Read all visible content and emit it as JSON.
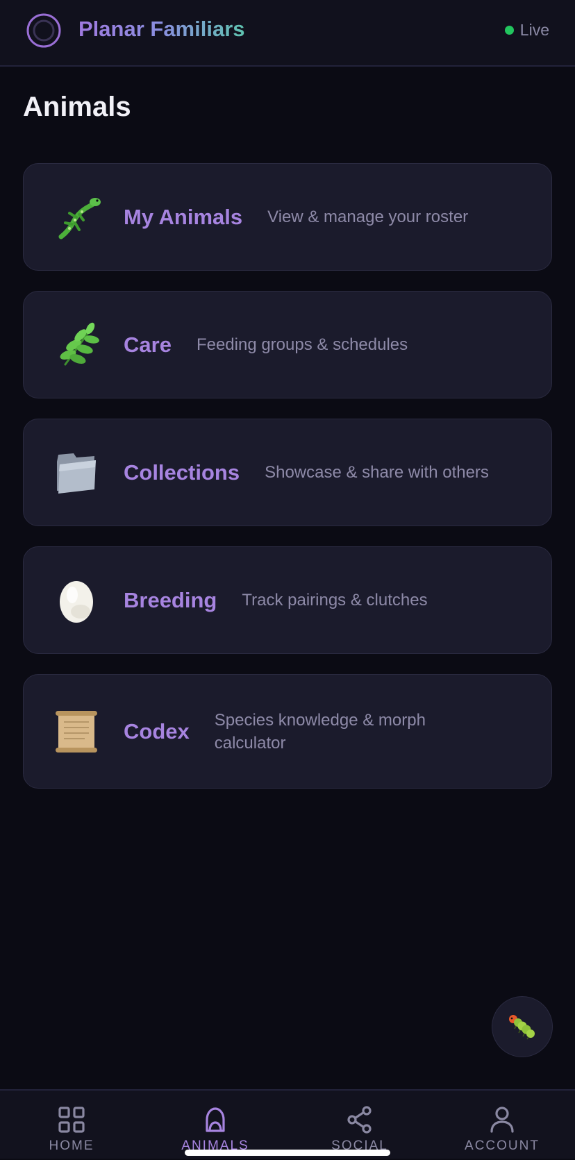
{
  "header": {
    "title": "Planar Familiars",
    "logo_icon": "ring-logo-icon",
    "status": {
      "text": "Live",
      "color": "#22c55e"
    }
  },
  "page": {
    "title": "Animals"
  },
  "cards": [
    {
      "label": "My Animals",
      "description": "View & manage your roster",
      "icon": "lizard-icon"
    },
    {
      "label": "Care",
      "description": "Feeding groups & schedules",
      "icon": "herb-icon"
    },
    {
      "label": "Collections",
      "description": "Showcase & share with others",
      "icon": "folder-icon"
    },
    {
      "label": "Breeding",
      "description": "Track pairings & clutches",
      "icon": "egg-icon"
    },
    {
      "label": "Codex",
      "description": "Species knowledge & morph calculator",
      "icon": "scroll-icon"
    }
  ],
  "fab": {
    "icon": "caterpillar-icon"
  },
  "tabs": [
    {
      "label": "HOME",
      "icon": "grid-icon",
      "active": false
    },
    {
      "label": "ANIMALS",
      "icon": "animal-icon",
      "active": true
    },
    {
      "label": "SOCIAL",
      "icon": "share-icon",
      "active": false
    },
    {
      "label": "ACCOUNT",
      "icon": "person-icon",
      "active": false
    }
  ],
  "colors": {
    "accent": "#a784e0",
    "background": "#0b0b14",
    "card": "#1b1b2c"
  }
}
